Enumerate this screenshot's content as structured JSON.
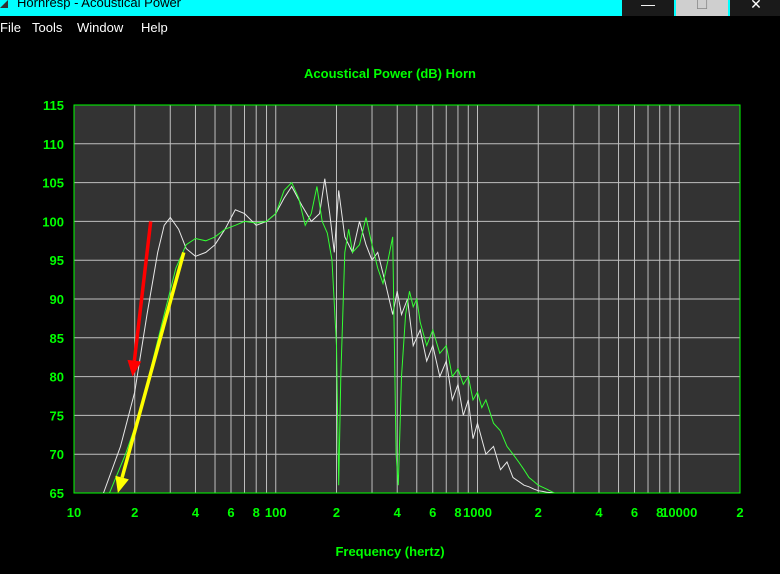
{
  "window": {
    "title": "Hornresp - Acoustical Power",
    "minimize_glyph": "—",
    "maximize_glyph": "☐",
    "close_glyph": "✕"
  },
  "menu": [
    "File",
    "Tools",
    "Window",
    "Help"
  ],
  "colors": {
    "titlebar": "#00ffff",
    "plot_bg": "#333333",
    "grid": "#bfbfbf",
    "text": "#00ff00",
    "trace_green": "#33ff33",
    "trace_white": "#e8e8e8",
    "arrow_red": "#ff0000",
    "arrow_yellow": "#ffff00"
  },
  "chart_data": {
    "type": "line",
    "title": "Acoustical Power (dB)   Horn",
    "xlabel": "Frequency (hertz)",
    "ylabel": "",
    "x_scale": "log",
    "xlim": [
      10,
      20000
    ],
    "ylim": [
      65,
      115
    ],
    "grid": true,
    "yticks": [
      65,
      70,
      75,
      80,
      85,
      90,
      95,
      100,
      105,
      110,
      115
    ],
    "xtick_labels": [
      {
        "value": 10,
        "label": "10"
      },
      {
        "value": 20,
        "label": "2"
      },
      {
        "value": 40,
        "label": "4"
      },
      {
        "value": 60,
        "label": "6"
      },
      {
        "value": 80,
        "label": "8"
      },
      {
        "value": 100,
        "label": "100"
      },
      {
        "value": 200,
        "label": "2"
      },
      {
        "value": 400,
        "label": "4"
      },
      {
        "value": 600,
        "label": "6"
      },
      {
        "value": 800,
        "label": "8"
      },
      {
        "value": 1000,
        "label": "1000"
      },
      {
        "value": 2000,
        "label": "2"
      },
      {
        "value": 4000,
        "label": "4"
      },
      {
        "value": 6000,
        "label": "6"
      },
      {
        "value": 8000,
        "label": "8"
      },
      {
        "value": 10000,
        "label": "10000"
      },
      {
        "value": 20000,
        "label": "2"
      }
    ],
    "series": [
      {
        "color": "#e8e8e8",
        "x": [
          14,
          17,
          20,
          23,
          26,
          28,
          30,
          33,
          36,
          40,
          45,
          50,
          56,
          63,
          70,
          80,
          90,
          100,
          110,
          120,
          135,
          150,
          165,
          175,
          185,
          195,
          205,
          220,
          240,
          260,
          280,
          300,
          320,
          350,
          380,
          400,
          420,
          450,
          480,
          520,
          560,
          600,
          650,
          700,
          750,
          800,
          850,
          900,
          950,
          1000,
          1100,
          1200,
          1300,
          1400,
          1500,
          1600,
          1700,
          1800,
          1900,
          2000,
          2100,
          2200,
          2400
        ],
        "y": [
          65,
          71,
          78,
          88,
          96,
          99.5,
          100.5,
          99,
          96.5,
          95.5,
          96,
          97,
          99,
          101.5,
          101,
          99.5,
          100,
          101,
          103,
          104.5,
          102,
          100,
          101,
          105.5,
          101,
          96,
          104,
          98,
          96,
          100,
          97,
          95,
          96,
          92,
          88,
          91,
          88,
          90,
          84,
          86,
          82,
          84,
          80,
          82,
          77,
          79,
          75,
          77,
          72,
          74,
          70,
          71,
          68,
          69,
          67,
          66.5,
          66,
          65.8,
          65.5,
          65.3,
          65.2,
          65.1,
          65
        ]
      },
      {
        "color": "#33ff33",
        "x": [
          15,
          18,
          21,
          24,
          28,
          32,
          36,
          40,
          45,
          50,
          56,
          63,
          70,
          80,
          90,
          100,
          110,
          120,
          130,
          140,
          150,
          160,
          170,
          180,
          190,
          200,
          205,
          210,
          220,
          230,
          240,
          260,
          280,
          300,
          320,
          340,
          360,
          380,
          395,
          405,
          420,
          440,
          460,
          480,
          500,
          520,
          560,
          600,
          650,
          700,
          750,
          800,
          850,
          900,
          950,
          1000,
          1050,
          1100,
          1200,
          1300,
          1400,
          1500,
          1600,
          1700,
          1800,
          1900,
          2000,
          2200,
          2400
        ],
        "y": [
          65,
          70,
          75,
          81,
          88,
          94,
          97,
          97.8,
          97.5,
          98,
          99,
          99.5,
          100,
          99.8,
          100,
          101,
          104,
          105,
          103,
          99.5,
          101,
          104.5,
          100,
          98.5,
          95,
          84,
          66,
          80,
          96,
          99,
          96,
          97,
          100.5,
          97,
          94,
          92,
          95,
          98,
          70,
          66,
          80,
          88,
          91,
          89,
          90,
          87,
          84,
          86,
          83,
          84,
          80,
          81,
          79,
          80,
          77,
          78,
          76,
          77,
          74,
          73,
          71,
          70,
          69,
          68,
          67,
          66.5,
          66,
          65.5,
          65
        ]
      }
    ],
    "annotations": [
      {
        "type": "arrow",
        "color": "#ff0000",
        "from": [
          24,
          100
        ],
        "to": [
          19.5,
          80
        ]
      },
      {
        "type": "arrow",
        "color": "#ffff00",
        "from": [
          35,
          96
        ],
        "to": [
          16.5,
          65
        ]
      }
    ]
  }
}
